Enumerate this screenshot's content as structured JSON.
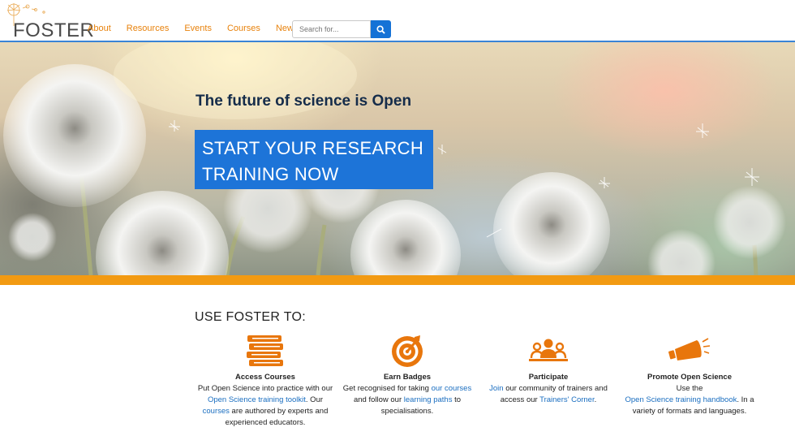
{
  "header": {
    "logo_text": "FOSTER",
    "nav": [
      "About",
      "Resources",
      "Events",
      "Courses",
      "News"
    ],
    "search_placeholder": "Search for..."
  },
  "hero": {
    "title": "The future of science is Open",
    "cta_line1": "START YOUR RESEARCH",
    "cta_line2": "TRAINING NOW"
  },
  "features": {
    "heading": "USE FOSTER TO:",
    "items": [
      {
        "icon": "books-icon",
        "title": "Access Courses",
        "parts": [
          "Put Open Science into practice with our ",
          "Open Science training toolkit",
          ". Our ",
          "courses",
          " are authored by experts and experienced educators."
        ]
      },
      {
        "icon": "target-badge-icon",
        "title": "Earn Badges",
        "parts": [
          "Get recognised for taking ",
          "our courses",
          " and follow our ",
          "learning paths",
          " to specialisations."
        ]
      },
      {
        "icon": "community-icon",
        "title": "Participate",
        "parts": [
          "Join",
          " our community of trainers and access our ",
          "Trainers' Corner",
          "."
        ]
      },
      {
        "icon": "megaphone-icon",
        "title": "Promote Open Science",
        "parts": [
          "Use the ",
          "Open Science training handbook",
          ". In a variety of formats and languages."
        ]
      }
    ]
  },
  "colors": {
    "accent_orange": "#e8820c",
    "orange_bar": "#f29a12",
    "cta_blue": "#1d74d8",
    "link_blue": "#1a6ec0"
  }
}
